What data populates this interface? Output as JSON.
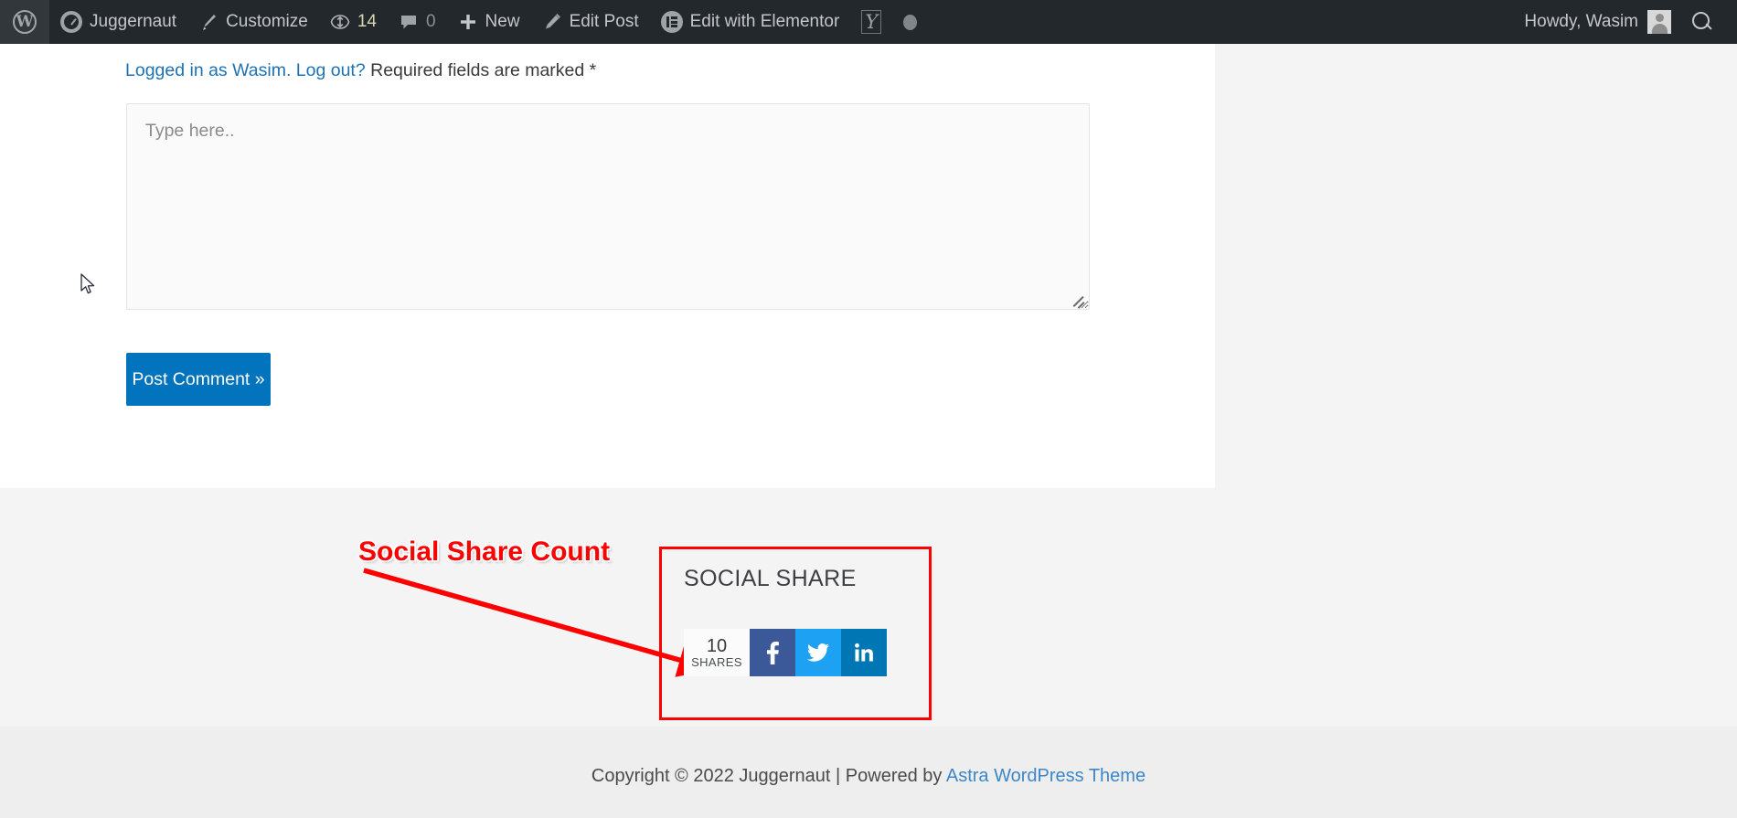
{
  "admin_bar": {
    "background_color": "#23282d",
    "left_items": [
      {
        "label": "",
        "icon": "wordpress-logo-icon"
      },
      {
        "label": "Juggernaut",
        "icon": "dashboard-gauge-icon"
      },
      {
        "label": "Customize",
        "icon": "paintbrush-icon"
      },
      {
        "label": "14",
        "icon": "updates-icon"
      },
      {
        "label": "0",
        "icon": "comment-bubble-icon"
      },
      {
        "label": "New",
        "icon": "plus-icon"
      },
      {
        "label": "Edit Post",
        "icon": "pencil-icon"
      },
      {
        "label": "Edit with Elementor",
        "icon": "elementor-icon"
      },
      {
        "label": "",
        "icon": "yoast-seo-icon"
      },
      {
        "label": "",
        "icon": "circle-dot-icon"
      }
    ],
    "site_name": "Juggernaut",
    "customize_label": "Customize",
    "updates_count": "14",
    "comments_count": "0",
    "new_label": "New",
    "edit_post_label": "Edit Post",
    "edit_elementor_label": "Edit with Elementor",
    "howdy_label": "Howdy, Wasim",
    "search_icon": "search-icon",
    "avatar_icon": "avatar"
  },
  "comment_form": {
    "logged_in_prefix": "Logged in as Wasim. Log out?",
    "required_note": "Required fields are marked *",
    "textarea_placeholder": "Type here..",
    "textarea_value": "",
    "submit_label": "Post Comment »",
    "submit_color": "#0274be"
  },
  "annotation": {
    "label": "Social Share Count",
    "color": "#fe0000"
  },
  "social_share": {
    "title": "SOCIAL SHARE",
    "count": "10",
    "count_label": "SHARES",
    "buttons": [
      {
        "name": "facebook-share-button",
        "icon": "facebook-icon",
        "color": "#3b5998"
      },
      {
        "name": "twitter-share-button",
        "icon": "twitter-icon",
        "color": "#1da1f2"
      },
      {
        "name": "linkedin-share-button",
        "icon": "linkedin-icon",
        "color": "#0077b5"
      }
    ],
    "facebook_color": "#3b5998",
    "twitter_color": "#1da1f2",
    "linkedin_color": "#0077b5",
    "highlight_border_color": "#fe0000"
  },
  "footer": {
    "copyright_text": "Copyright © 2022 Juggernaut | Powered by ",
    "theme_link_label": "Astra WordPress Theme"
  }
}
